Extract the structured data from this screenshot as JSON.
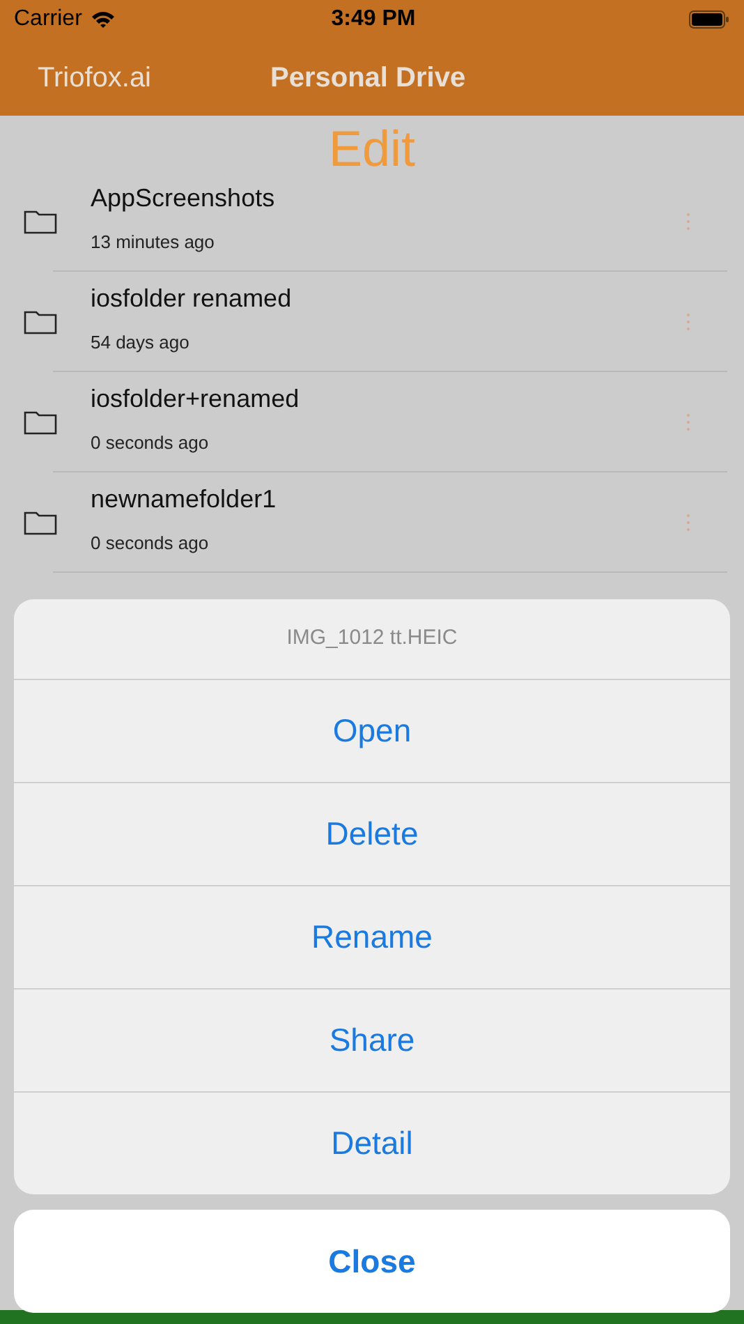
{
  "status_bar": {
    "carrier": "Carrier",
    "time": "3:49 PM"
  },
  "nav": {
    "back": "Triofox.ai",
    "title": "Personal Drive"
  },
  "edit": "Edit",
  "files": [
    {
      "name": "AppScreenshots",
      "modified": "13 minutes ago"
    },
    {
      "name": "iosfolder renamed",
      "modified": "54 days ago"
    },
    {
      "name": "iosfolder+renamed",
      "modified": "0 seconds ago"
    },
    {
      "name": "newnamefolder1",
      "modified": "0 seconds ago"
    }
  ],
  "action_sheet": {
    "title": "IMG_1012 tt.HEIC",
    "actions": [
      "Open",
      "Delete",
      "Rename",
      "Share",
      "Detail"
    ],
    "cancel": "Close"
  }
}
